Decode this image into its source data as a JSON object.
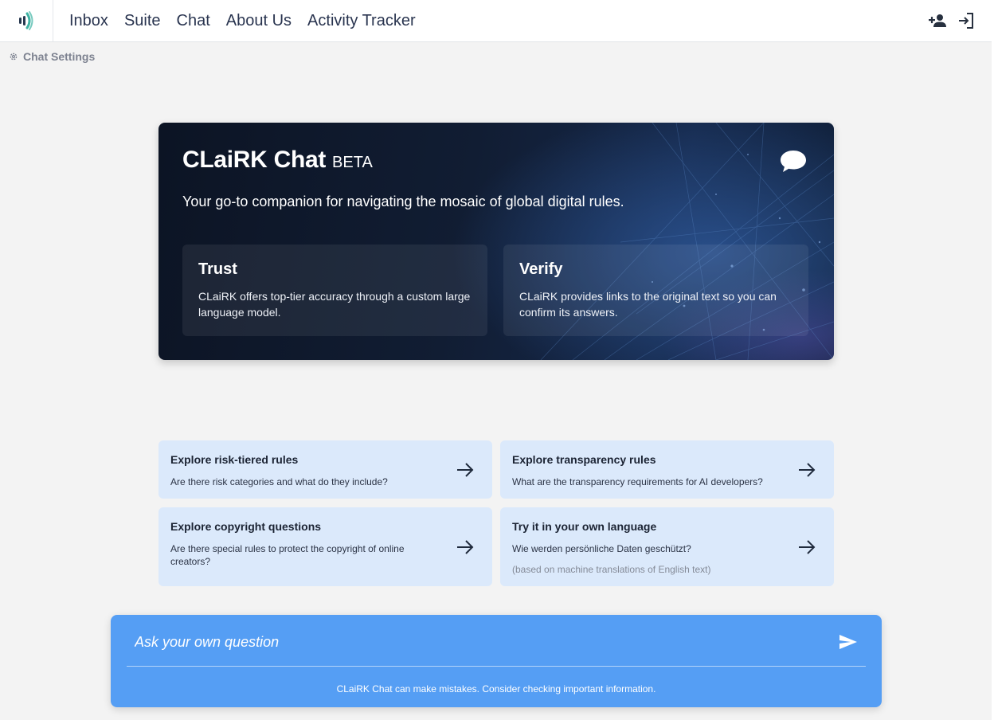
{
  "nav": {
    "items": [
      {
        "label": "Inbox"
      },
      {
        "label": "Suite"
      },
      {
        "label": "Chat"
      },
      {
        "label": "About Us"
      },
      {
        "label": "Activity Tracker"
      }
    ],
    "icons": [
      "logo-icon",
      "add-user-icon",
      "login-icon"
    ]
  },
  "settings": {
    "label": "Chat Settings",
    "icon": "gear-icon"
  },
  "hero": {
    "title": "CLaiRK Chat",
    "badge": "BETA",
    "subtitle": "Your go-to companion for navigating the mosaic of global digital rules.",
    "icon": "chat-bubble-icon",
    "cards": [
      {
        "title": "Trust",
        "text": "CLaiRK offers top-tier accuracy through a custom large language model."
      },
      {
        "title": "Verify",
        "text": "CLaiRK provides links to the original text so you can confirm its answers."
      }
    ]
  },
  "suggestions": [
    {
      "title": "Explore risk-tiered rules",
      "text": "Are there risk categories and what do they include?",
      "note": ""
    },
    {
      "title": "Explore transparency rules",
      "text": "What are the transparency requirements for AI developers?",
      "note": ""
    },
    {
      "title": "Explore copyright questions",
      "text": "Are there special rules to protect the copyright of online creators?",
      "note": ""
    },
    {
      "title": "Try it in your own language",
      "text": "Wie werden persönliche Daten geschützt?",
      "note": "(based on machine translations of English text)"
    }
  ],
  "ask": {
    "placeholder": "Ask your own question",
    "value": "",
    "disclaimer": "CLaiRK Chat can make mistakes. Consider checking important information.",
    "send_icon": "send-icon"
  },
  "colors": {
    "accent": "#559ef4",
    "card_bg": "#dbe9fb",
    "hero_bg": "#0c1424",
    "page_bg": "#f3f3f3"
  }
}
